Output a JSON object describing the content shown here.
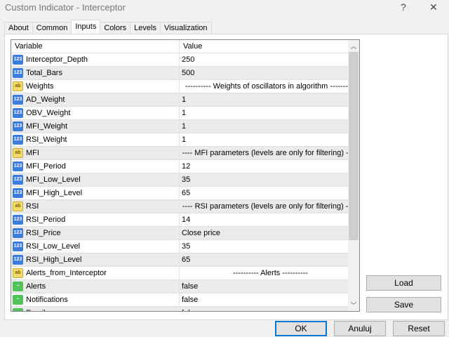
{
  "window": {
    "title": "Custom Indicator - Interceptor",
    "help": "?",
    "close": "✕"
  },
  "tabs": [
    "About",
    "Common",
    "Inputs",
    "Colors",
    "Levels",
    "Visualization"
  ],
  "active_tab": "Inputs",
  "table": {
    "headers": [
      "Variable",
      "Value"
    ],
    "rows": [
      {
        "type": "int",
        "name": "Interceptor_Depth",
        "value": "250"
      },
      {
        "type": "int",
        "name": "Total_Bars",
        "value": "500"
      },
      {
        "type": "str",
        "name": "Weights",
        "value": "---------- Weights of oscillators in algorithm ----------",
        "sep": true
      },
      {
        "type": "int",
        "name": "AD_Weight",
        "value": "1"
      },
      {
        "type": "int",
        "name": "OBV_Weight",
        "value": "1"
      },
      {
        "type": "int",
        "name": "MFI_Weight",
        "value": "1"
      },
      {
        "type": "int",
        "name": "RSI_Weight",
        "value": "1"
      },
      {
        "type": "str",
        "name": "MFI",
        "value": "---- MFI parameters (levels are only for filtering) -----",
        "sep": true
      },
      {
        "type": "int",
        "name": "MFI_Period",
        "value": "12"
      },
      {
        "type": "int",
        "name": "MFI_Low_Level",
        "value": "35"
      },
      {
        "type": "int",
        "name": "MFI_High_Level",
        "value": "65"
      },
      {
        "type": "str",
        "name": "RSI",
        "value": "---- RSI parameters (levels are only for filtering) -----",
        "sep": true
      },
      {
        "type": "int",
        "name": "RSI_Period",
        "value": "14"
      },
      {
        "type": "int",
        "name": "RSI_Price",
        "value": "Close price"
      },
      {
        "type": "int",
        "name": "RSI_Low_Level",
        "value": "35"
      },
      {
        "type": "int",
        "name": "RSI_High_Level",
        "value": "65"
      },
      {
        "type": "str",
        "name": "Alerts_from_Interceptor",
        "value": "---------- Alerts ----------",
        "sep": true
      },
      {
        "type": "bool",
        "name": "Alerts",
        "value": "false"
      },
      {
        "type": "bool",
        "name": "Notifications",
        "value": "false"
      },
      {
        "type": "bool",
        "name": "Email",
        "value": "false"
      }
    ]
  },
  "icons": {
    "int": "123",
    "str": "ab",
    "bool": "~"
  },
  "buttons": {
    "load": "Load",
    "save": "Save",
    "ok": "OK",
    "cancel": "Anuluj",
    "reset": "Reset"
  }
}
